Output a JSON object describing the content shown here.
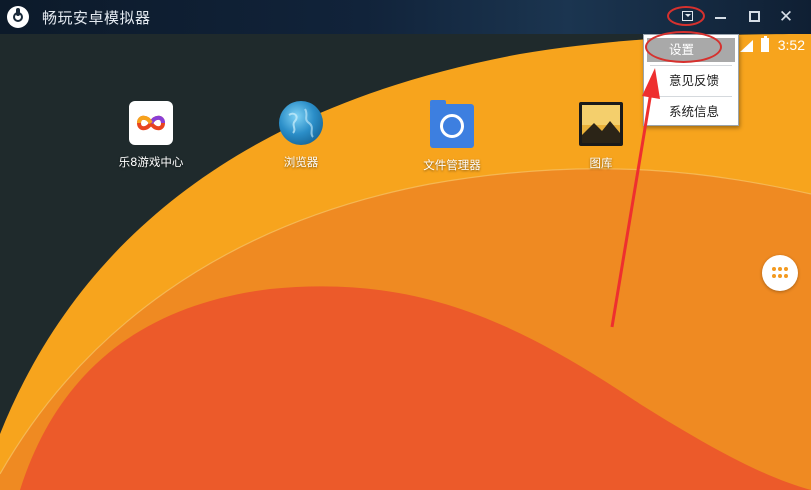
{
  "window": {
    "title": "畅玩安卓模拟器"
  },
  "titlebar": {
    "dropdown_icon": "caret-square-icon",
    "minimize_icon": "minimize-icon",
    "maximize_icon": "maximize-icon",
    "close_glyph": "✕"
  },
  "status_bar": {
    "time": "3:52"
  },
  "desktop": {
    "apps": [
      {
        "label": "乐8游戏中心",
        "icon": "infinity-logo-icon"
      },
      {
        "label": "浏览器",
        "icon": "globe-icon"
      },
      {
        "label": "文件管理器",
        "icon": "folder-icon"
      },
      {
        "label": "图库",
        "icon": "gallery-icon"
      }
    ]
  },
  "menu": {
    "items": [
      {
        "label": "设置",
        "selected": true
      },
      {
        "label": "意见反馈",
        "selected": false
      },
      {
        "label": "系统信息",
        "selected": false
      }
    ]
  },
  "colors": {
    "highlight_ring": "#d6312e",
    "wallpaper_yellow": "#f7a41d",
    "wallpaper_orange": "#ef8a22",
    "wallpaper_red": "#ec5a2a"
  }
}
